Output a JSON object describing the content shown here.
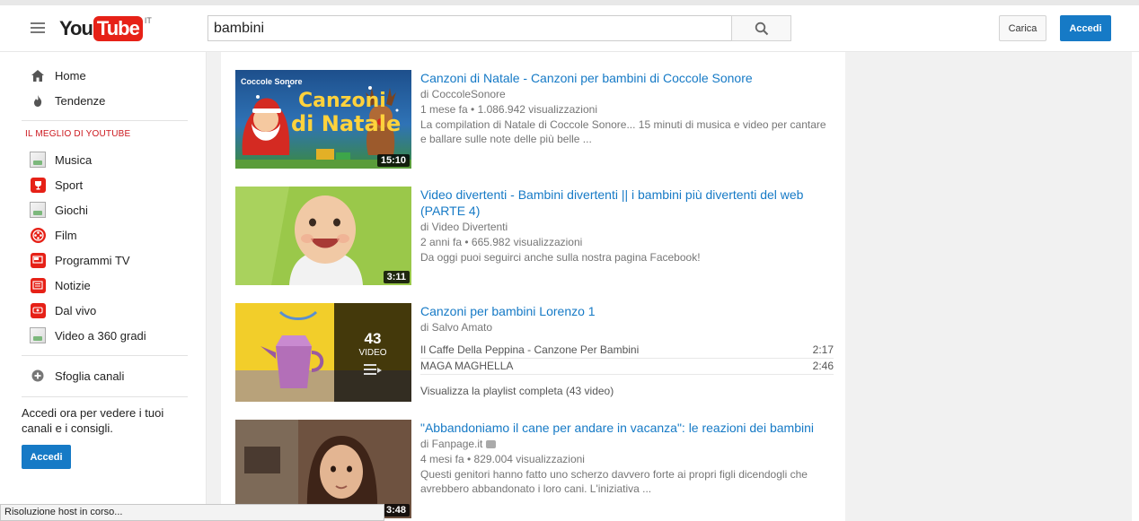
{
  "header": {
    "logo_you": "You",
    "logo_tube": "Tube",
    "logo_country": "IT",
    "search_value": "bambini",
    "upload_label": "Carica",
    "signin_label": "Accedi"
  },
  "sidebar": {
    "top_items": [
      {
        "label": "Home",
        "icon": "home-icon"
      },
      {
        "label": "Tendenze",
        "icon": "flame-icon"
      }
    ],
    "section_title": "IL MEGLIO DI YOUTUBE",
    "best_items": [
      {
        "label": "Musica",
        "icon": "broken-image-icon"
      },
      {
        "label": "Sport",
        "icon": "trophy-icon"
      },
      {
        "label": "Giochi",
        "icon": "broken-image-icon"
      },
      {
        "label": "Film",
        "icon": "film-reel-icon"
      },
      {
        "label": "Programmi TV",
        "icon": "tv-icon"
      },
      {
        "label": "Notizie",
        "icon": "newspaper-icon"
      },
      {
        "label": "Dal vivo",
        "icon": "live-icon"
      },
      {
        "label": "Video a 360 gradi",
        "icon": "broken-image-icon"
      }
    ],
    "browse_channels": "Sfoglia canali",
    "signin_prompt": "Accedi ora per vedere i tuoi canali e i consigli.",
    "signin_button": "Accedi"
  },
  "results": [
    {
      "title": "Canzoni di Natale - Canzoni per bambini di Coccole Sonore",
      "channel": "di CoccoleSonore",
      "meta": "1 mese fa • 1.086.942 visualizzazioni",
      "description": "La compilation di Natale di Coccole Sonore... 15 minuti di musica e video per cantare e ballare sulle note delle più belle ...",
      "duration": "15:10",
      "thumb_text_top": "Coccole Sonore",
      "thumb_text_main": "Canzoni",
      "thumb_text_sub": "di Natale"
    },
    {
      "title": "Video divertenti - Bambini divertenti || i bambini più divertenti del web (PARTE 4)",
      "channel": "di Video Divertenti",
      "meta": "2 anni fa • 665.982 visualizzazioni",
      "description": "Da oggi puoi seguirci anche sulla nostra pagina Facebook!",
      "duration": "3:11"
    },
    {
      "title": "Canzoni per bambini Lorenzo 1",
      "channel": "di Salvo Amato",
      "playlist_count": "43",
      "playlist_label": "VIDEO",
      "playlist_items": [
        {
          "name": "Il Caffe Della Peppina - Canzone Per Bambini",
          "duration": "2:17"
        },
        {
          "name": "MAGA MAGHELLA",
          "duration": "2:46"
        }
      ],
      "playlist_all": "Visualizza la playlist completa (43 video)"
    },
    {
      "title": "\"Abbandoniamo il cane per andare in vacanza\": le reazioni dei bambini",
      "channel": "di Fanpage.it",
      "meta": "4 mesi fa • 829.004 visualizzazioni",
      "description": "Questi genitori hanno fatto uno scherzo davvero forte ai propri figli dicendogli che avrebbero abbandonato i loro cani. L'iniziativa ...",
      "duration": "3:48"
    }
  ],
  "status_bar": "Risoluzione host in corso...",
  "colors": {
    "brand_red": "#e62117",
    "link_blue": "#167ac6",
    "section_red": "#cc181e"
  }
}
